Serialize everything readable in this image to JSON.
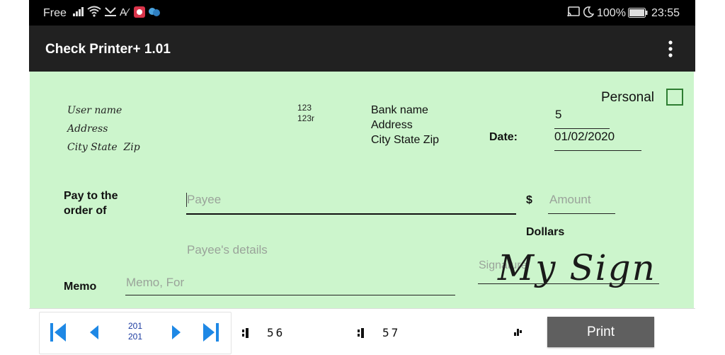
{
  "status_bar": {
    "carrier": "Free",
    "battery": "100%",
    "time": "23:55"
  },
  "app_bar": {
    "title": "Check Printer+ 1.01",
    "menu_icon": "more-vert-icon"
  },
  "check": {
    "user_block": [
      "User name",
      "Address",
      "City State  Zip"
    ],
    "routing_small": [
      "123",
      "123r"
    ],
    "bank_block": [
      "Bank name",
      "Address",
      "City State Zip"
    ],
    "personal_label": "Personal",
    "personal_checked": false,
    "check_number": "5",
    "date_label": "Date:",
    "date_value": "01/02/2020",
    "pay_to_label": [
      "Pay to the",
      "order of"
    ],
    "payee_placeholder": "Payee",
    "dollar_sign": "$",
    "amount_placeholder": "Amount",
    "dollars_label": "Dollars",
    "payee_details_placeholder": "Payee's details",
    "memo_label": "Memo",
    "memo_placeholder": "Memo, For",
    "signature_placeholder": "Signature",
    "signature_text": "My Sign",
    "accent_color": "#ccf5cc"
  },
  "bottom_bar": {
    "page_top": "201",
    "page_bottom": "201",
    "micr_routing": "56",
    "micr_account": "57",
    "print_label": "Print",
    "nav_color": "#1e88e5"
  }
}
